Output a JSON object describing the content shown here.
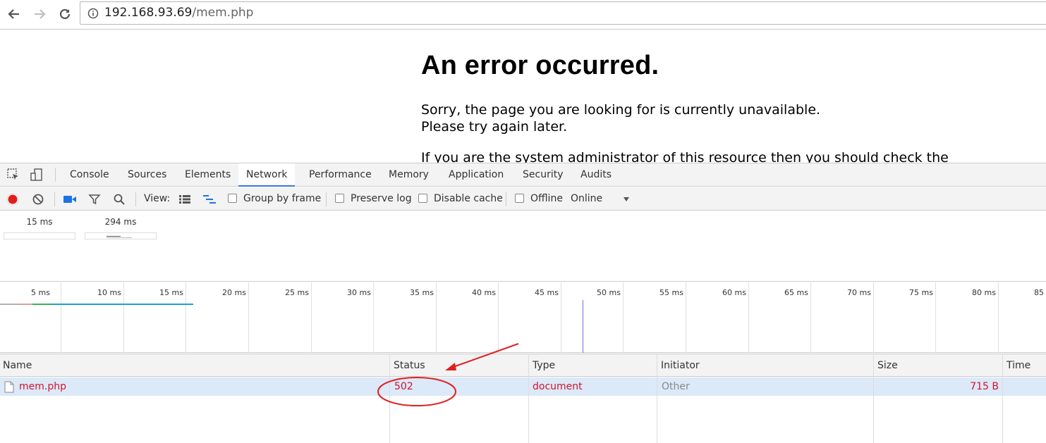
{
  "browser": {
    "url_host": "192.168.93.69",
    "url_path": "/mem.php"
  },
  "page": {
    "heading": "An error occurred.",
    "line1": "Sorry, the page you are looking for is currently unavailable.",
    "line2": "Please try again later.",
    "line3": "If you are the system administrator of this resource then you should check the"
  },
  "devtools": {
    "tabs": [
      "Console",
      "Sources",
      "Elements",
      "Network",
      "Performance",
      "Memory",
      "Application",
      "Security",
      "Audits"
    ],
    "active_tab": "Network",
    "toolbar": {
      "view_label": "View:",
      "group_by_frame": "Group by frame",
      "preserve_log": "Preserve log",
      "disable_cache": "Disable cache",
      "offline": "Offline",
      "throttle": "Online"
    },
    "filmstrip": [
      "15 ms",
      "294 ms"
    ],
    "timeline_ticks": [
      "5 ms",
      "10 ms",
      "15 ms",
      "20 ms",
      "25 ms",
      "30 ms",
      "35 ms",
      "40 ms",
      "45 ms",
      "50 ms",
      "55 ms",
      "60 ms",
      "65 ms",
      "70 ms",
      "75 ms",
      "80 ms",
      "85"
    ],
    "columns": [
      "Name",
      "Status",
      "Type",
      "Initiator",
      "Size",
      "Time"
    ],
    "rows": [
      {
        "name": "mem.php",
        "status": "502",
        "type": "document",
        "initiator": "Other",
        "size": "715 B",
        "time": ""
      }
    ]
  },
  "colors": {
    "error_red": "#d0142c",
    "accent_blue": "#3879d9",
    "annotation_red": "#e02020"
  }
}
